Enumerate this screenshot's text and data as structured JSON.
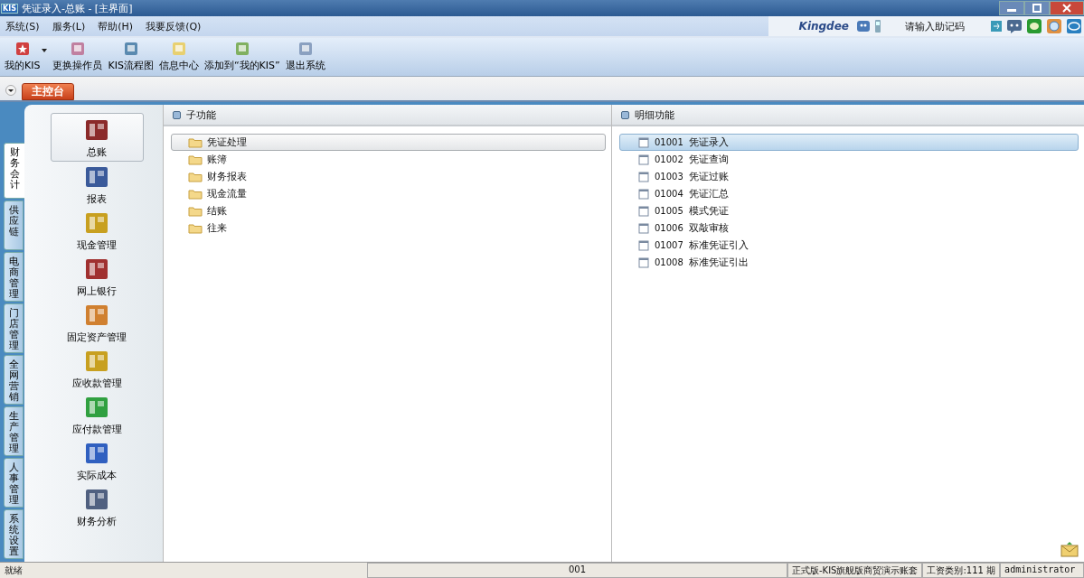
{
  "window": {
    "title": "凭证录入-总账 - [主界面]",
    "app_badge": "KIS"
  },
  "menu": [
    "系统(S)",
    "服务(L)",
    "帮助(H)",
    "我要反馈(Q)"
  ],
  "brand": {
    "logo": "Kingdee",
    "search_placeholder": "请输入助记码"
  },
  "toolbar": [
    {
      "label": "我的KIS",
      "dropdown": true
    },
    {
      "label": "更换操作员",
      "dropdown": false
    },
    {
      "label": "KIS流程图",
      "dropdown": false
    },
    {
      "label": "信息中心",
      "dropdown": false
    },
    {
      "label": "添加到“我的KIS”",
      "dropdown": false
    },
    {
      "label": "退出系统",
      "dropdown": false
    }
  ],
  "console_tab": "主控台",
  "side_tabs": [
    {
      "label": "财务会计",
      "selected": true
    },
    {
      "label": "供应链",
      "selected": false
    },
    {
      "label": "电商管理",
      "selected": false
    },
    {
      "label": "门店管理",
      "selected": false
    },
    {
      "label": "全网营销",
      "selected": false
    },
    {
      "label": "生产管理",
      "selected": false
    },
    {
      "label": "人事管理",
      "selected": false
    },
    {
      "label": "系统设置",
      "selected": false
    }
  ],
  "modules": [
    {
      "label": "总账",
      "selected": true
    },
    {
      "label": "报表",
      "selected": false
    },
    {
      "label": "现金管理",
      "selected": false
    },
    {
      "label": "网上银行",
      "selected": false
    },
    {
      "label": "固定资产管理",
      "selected": false
    },
    {
      "label": "应收款管理",
      "selected": false
    },
    {
      "label": "应付款管理",
      "selected": false
    },
    {
      "label": "实际成本",
      "selected": false
    },
    {
      "label": "财务分析",
      "selected": false
    }
  ],
  "sub_panel": {
    "title": "子功能",
    "items": [
      {
        "label": "凭证处理",
        "selected": true
      },
      {
        "label": "账簿",
        "selected": false
      },
      {
        "label": "财务报表",
        "selected": false
      },
      {
        "label": "现金流量",
        "selected": false
      },
      {
        "label": "结账",
        "selected": false
      },
      {
        "label": "往来",
        "selected": false
      }
    ]
  },
  "detail_panel": {
    "title": "明细功能",
    "items": [
      {
        "code": "01001",
        "label": "凭证录入",
        "selected": true
      },
      {
        "code": "01002",
        "label": "凭证查询",
        "selected": false
      },
      {
        "code": "01003",
        "label": "凭证过账",
        "selected": false
      },
      {
        "code": "01004",
        "label": "凭证汇总",
        "selected": false
      },
      {
        "code": "01005",
        "label": "模式凭证",
        "selected": false
      },
      {
        "code": "01006",
        "label": "双敲审核",
        "selected": false
      },
      {
        "code": "01007",
        "label": "标准凭证引入",
        "selected": false
      },
      {
        "code": "01008",
        "label": "标准凭证引出",
        "selected": false
      }
    ]
  },
  "status_bar": [
    "就绪",
    "001",
    "正式版-KIS旗舰版商贸演示账套",
    "工资类别:111 期",
    "administrator"
  ]
}
